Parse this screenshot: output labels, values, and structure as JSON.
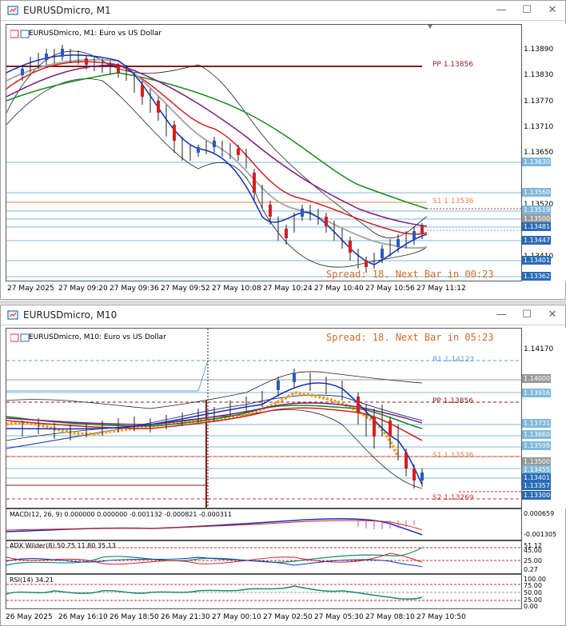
{
  "m1": {
    "title": "EURUSDmicro, M1",
    "header": "EURUSDmicro, M1:  Euro vs US Dollar",
    "prices": [
      "1.13890",
      "1.13830",
      "1.13770",
      "1.13710",
      "1.13650",
      "1.13520",
      "1.13410"
    ],
    "labels": [
      "1.13630",
      "1.13560",
      "1.13519",
      "1.13500",
      "1.13481",
      "1.13447",
      "1.13401",
      "1.13362"
    ],
    "pp": "PP 1.13856",
    "s1": "S1 1.13536",
    "spread": "Spread: 18. Next Bar in 00:23",
    "times": [
      "27 May 2025",
      "27 May 09:20",
      "27 May 09:36",
      "27 May 09:52",
      "27 May 10:08",
      "27 May 10:24",
      "27 May 10:40",
      "27 May 10:56",
      "27 May 11:12"
    ]
  },
  "m10": {
    "title": "EURUSDmicro, M10",
    "header": "EURUSDmicro, M10:  Euro vs US Dollar",
    "spread": "Spread: 18. Next Bar in 05:23",
    "prices": [
      "1.14170",
      "1.14000",
      "1.13916",
      "1.13731",
      "1.13660",
      "1.13598",
      "1.13500",
      "1.13455",
      "1.13401",
      "1.13357",
      "1.13300"
    ],
    "r1": "R1 1.14123",
    "pp": "PP 1.13856",
    "s1": "S1 1.13536",
    "s2": "S2 1.13269",
    "macd": "MACD(12, 26, 9) 0.000000 0.000000 -0.001132 -0.000821 -0.000311",
    "macd_axis": [
      "0.000659",
      "-0.001305"
    ],
    "adx": "ADX Wilder(8) 50.75 11.80 35.13",
    "adx_axis": [
      "51.12",
      "45.00",
      "25.00",
      "0.27"
    ],
    "rsi": "RSI(14) 34.21",
    "rsi_axis": [
      "100.00",
      "75.00",
      "50.00",
      "25.00",
      "0.00"
    ],
    "times": [
      "26 May 2025",
      "26 May 16:10",
      "26 May 18:50",
      "26 May 21:30",
      "27 May 00:10",
      "27 May 02:50",
      "27 May 05:30",
      "27 May 08:10",
      "27 May 10:50"
    ]
  },
  "window_buttons": {
    "minimize": "—",
    "maximize": "☐",
    "close": "✕"
  },
  "colors": {
    "pp": "#8b1a1a",
    "s1": "#e8844a",
    "spread": "#d26b2a",
    "r1": "#5aa0d8"
  }
}
